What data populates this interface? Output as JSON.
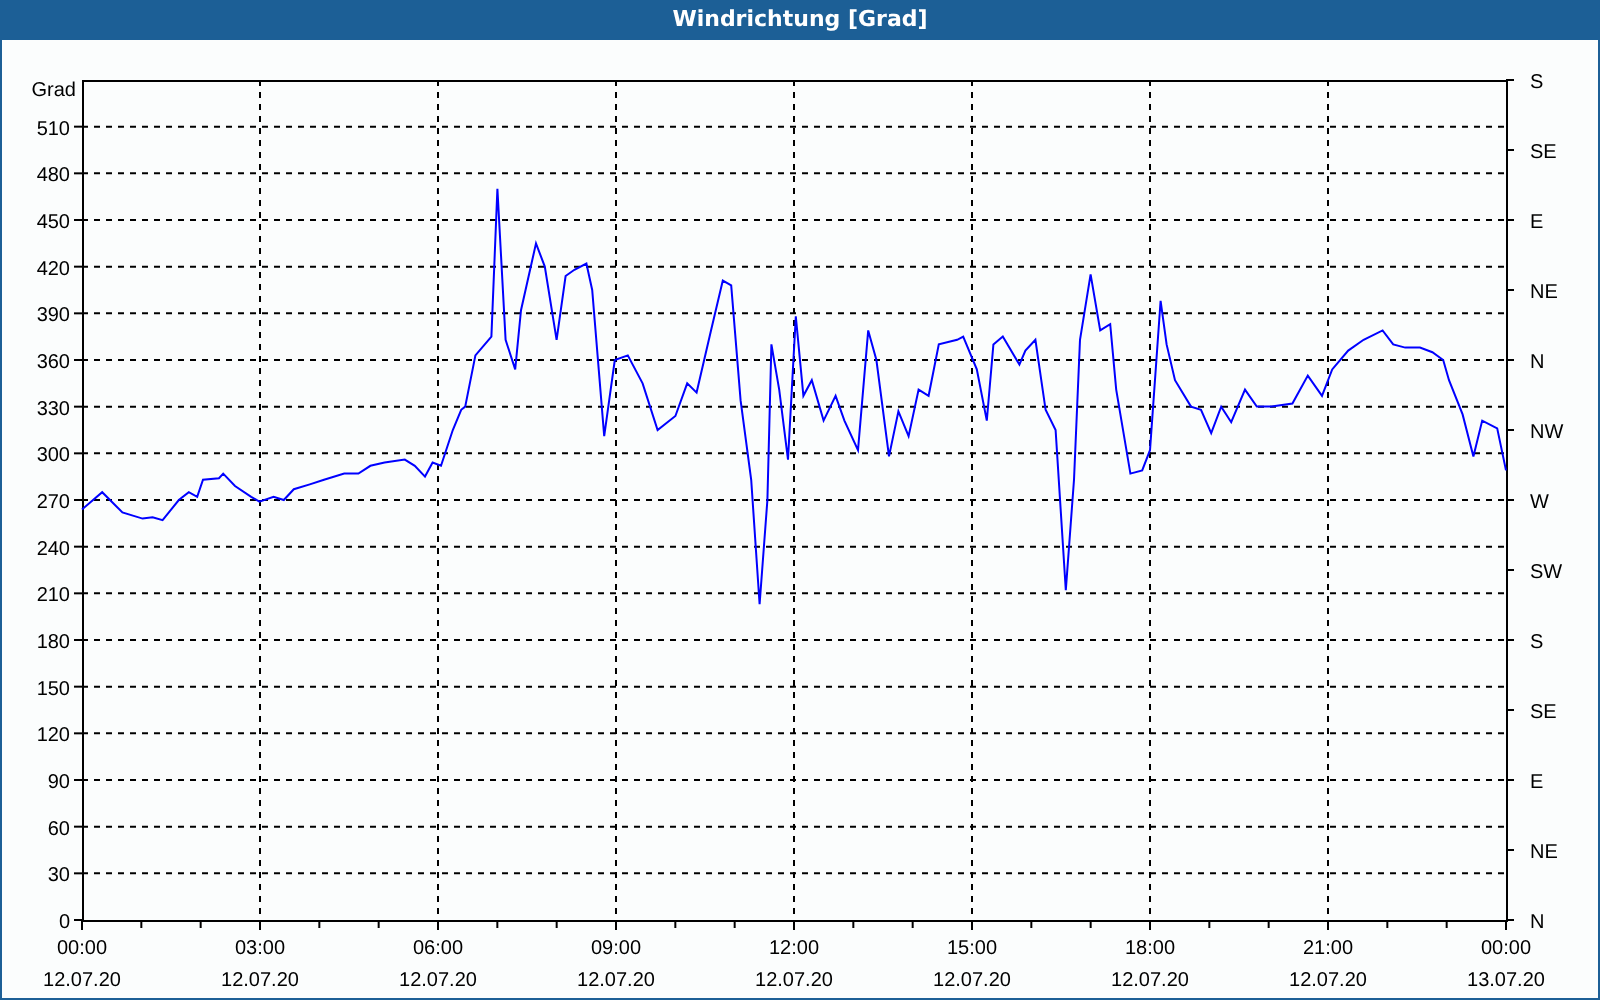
{
  "window": {
    "title": "Windrichtung [Grad]"
  },
  "chart": {
    "y_unit_label": "Grad",
    "compass_labels": [
      "S",
      "SE",
      "E",
      "NE",
      "N",
      "NW",
      "W",
      "SW",
      "S",
      "SE",
      "E",
      "NE",
      "N"
    ],
    "x_tick_dates": [
      "12.07.20",
      "12.07.20",
      "12.07.20",
      "12.07.20",
      "12.07.20",
      "12.07.20",
      "12.07.20",
      "12.07.20",
      "13.07.20"
    ],
    "chart_data": {
      "type": "line",
      "grid": true,
      "xlim": [
        0,
        24
      ],
      "ylim": [
        0,
        540
      ],
      "yticks": [
        0,
        30,
        60,
        90,
        120,
        150,
        180,
        210,
        240,
        270,
        300,
        330,
        360,
        390,
        420,
        450,
        480,
        510
      ],
      "xticks": [
        {
          "value": 0,
          "label": "00:00"
        },
        {
          "value": 3,
          "label": "03:00"
        },
        {
          "value": 6,
          "label": "06:00"
        },
        {
          "value": 9,
          "label": "09:00"
        },
        {
          "value": 12,
          "label": "12:00"
        },
        {
          "value": 15,
          "label": "15:00"
        },
        {
          "value": 18,
          "label": "18:00"
        },
        {
          "value": 21,
          "label": "21:00"
        },
        {
          "value": 24,
          "label": "00:00"
        }
      ],
      "x": [
        0,
        0.34,
        0.68,
        1.02,
        1.19,
        1.36,
        1.63,
        1.8,
        1.94,
        2.04,
        2.31,
        2.38,
        2.58,
        2.85,
        2.99,
        3.23,
        3.4,
        3.57,
        3.84,
        4.08,
        4.42,
        4.66,
        4.86,
        5.1,
        5.44,
        5.61,
        5.78,
        5.91,
        6.05,
        6.25,
        6.39,
        6.46,
        6.63,
        6.9,
        7.0,
        7.14,
        7.3,
        7.4,
        7.65,
        7.8,
        8.0,
        8.15,
        8.3,
        8.5,
        8.6,
        8.8,
        8.98,
        9.2,
        9.45,
        9.7,
        10,
        10.2,
        10.36,
        10.6,
        10.8,
        10.94,
        11.1,
        11.28,
        11.42,
        11.55,
        11.62,
        11.75,
        11.9,
        12.03,
        12.16,
        12.3,
        12.5,
        12.7,
        12.85,
        13.08,
        13.25,
        13.39,
        13.6,
        13.76,
        13.93,
        14.1,
        14.27,
        14.44,
        14.75,
        14.85,
        15.08,
        15.25,
        15.36,
        15.52,
        15.8,
        15.9,
        16.07,
        16.24,
        16.41,
        16.58,
        16.72,
        16.82,
        17,
        17.16,
        17.33,
        17.43,
        17.67,
        17.87,
        18,
        18.18,
        18.28,
        18.42,
        18.69,
        18.86,
        19.03,
        19.2,
        19.37,
        19.6,
        19.8,
        20.05,
        20.4,
        20.66,
        20.9,
        21.07,
        21.34,
        21.6,
        21.92,
        22.1,
        22.3,
        22.55,
        22.76,
        22.94,
        23.04,
        23.27,
        23.45,
        23.6,
        23.85,
        24
      ],
      "series": [
        {
          "color": "#0000ff",
          "values": [
            264,
            275,
            262,
            258,
            259,
            257,
            270,
            275,
            272,
            283,
            284,
            287,
            279,
            272,
            269,
            272,
            270,
            277,
            280,
            283,
            287,
            287,
            292,
            294,
            296,
            292,
            285,
            294,
            292,
            315,
            328,
            330,
            363,
            375,
            470,
            373,
            354,
            392,
            435,
            420,
            373,
            414,
            418,
            422,
            405,
            311,
            360,
            363,
            345,
            315,
            324,
            345,
            339,
            379,
            411,
            408,
            334,
            283,
            203,
            270,
            370,
            341,
            296,
            388,
            337,
            347,
            321,
            337,
            321,
            302,
            379,
            360,
            298,
            327,
            311,
            341,
            337,
            370,
            373,
            375,
            354,
            321,
            370,
            375,
            357,
            366,
            373,
            328,
            315,
            212,
            283,
            373,
            415,
            379,
            383,
            341,
            287,
            289,
            302,
            398,
            370,
            347,
            330,
            328,
            313,
            330,
            320,
            341,
            330,
            330,
            332,
            350,
            337,
            354,
            366,
            373,
            379,
            370,
            368,
            368,
            365,
            360,
            347,
            325,
            298,
            321,
            316,
            289
          ]
        }
      ]
    }
  }
}
